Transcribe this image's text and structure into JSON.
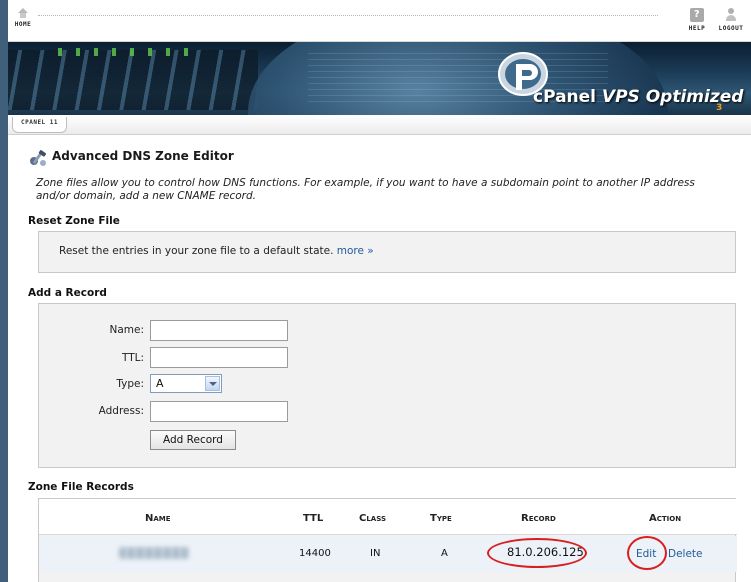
{
  "topbar": {
    "home_label": "HOME",
    "help_label": "HELP",
    "logout_label": "LOGOUT"
  },
  "banner": {
    "brand_cpanel": "cPanel",
    "brand_product": " VPS Optimized",
    "brand_version": "3"
  },
  "breadcrumb": {
    "label": "CPANEL 11"
  },
  "page": {
    "title": "Advanced DNS Zone Editor",
    "intro": "Zone files allow you to control how DNS functions. For example, if you want to have a subdomain point to another IP address and/or domain, add a new CNAME record."
  },
  "reset_zone": {
    "heading": "Reset Zone File",
    "text": "Reset the entries in your zone file to a default state. ",
    "more_link": "more »"
  },
  "add_record": {
    "heading": "Add a Record",
    "name_label": "Name:",
    "name_value": "",
    "ttl_label": "TTL:",
    "ttl_value": "",
    "type_label": "Type:",
    "type_value": "A",
    "address_label": "Address:",
    "address_value": "",
    "submit_label": "Add Record"
  },
  "zone_records": {
    "heading": "Zone File Records",
    "columns": {
      "name": "Name",
      "ttl": "TTL",
      "class": "Class",
      "type": "Type",
      "record": "Record",
      "action": "Action"
    },
    "rows": [
      {
        "ttl": "14400",
        "class": "IN",
        "type": "A",
        "record": "81.0.206.125",
        "edit_label": "Edit",
        "delete_label": "Delete"
      }
    ]
  },
  "colors": {
    "link": "#1f5a9a",
    "annotation_red": "#d81e1e",
    "panel_bg": "#f2f2f2",
    "outer_frame": "#3f5f7a"
  }
}
